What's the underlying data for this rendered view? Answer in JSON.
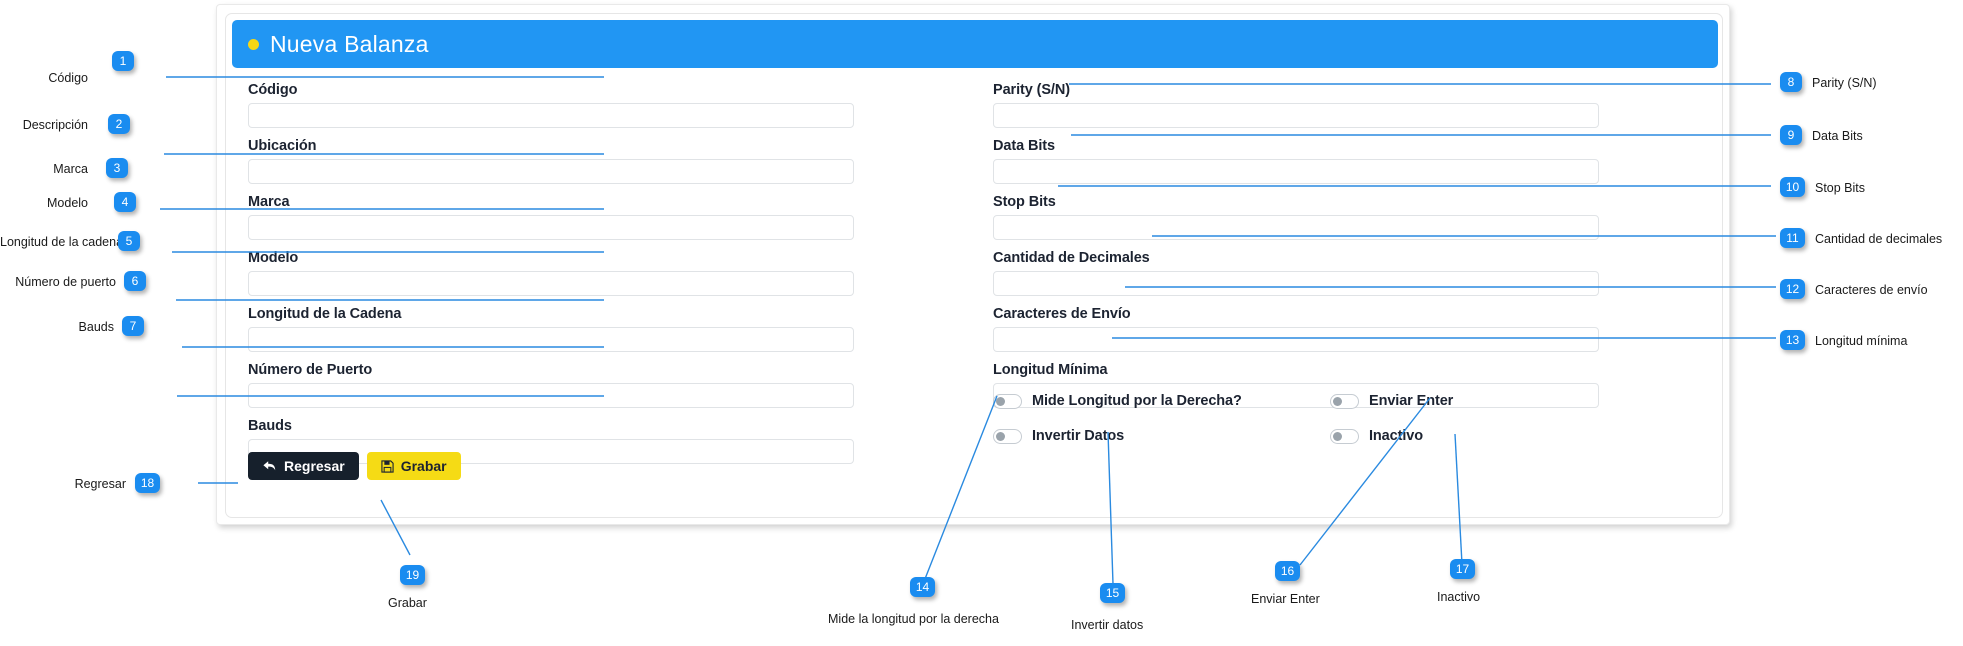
{
  "header": {
    "title": "Nueva Balanza",
    "dot_color": "#f7d714",
    "bar_color": "#2196f3"
  },
  "form": {
    "left_fields": [
      {
        "label": "Código",
        "value": "",
        "placeholder": ""
      },
      {
        "label": "Ubicación",
        "value": "",
        "placeholder": ""
      },
      {
        "label": "Marca",
        "value": "",
        "placeholder": ""
      },
      {
        "label": "Modelo",
        "value": "",
        "placeholder": ""
      },
      {
        "label": "Longitud de la Cadena",
        "value": "",
        "placeholder": ""
      },
      {
        "label": "Número de Puerto",
        "value": "",
        "placeholder": ""
      },
      {
        "label": "Bauds",
        "value": "",
        "placeholder": ""
      }
    ],
    "right_fields": [
      {
        "label": "Parity (S/N)",
        "value": "",
        "placeholder": ""
      },
      {
        "label": "Data Bits",
        "value": "",
        "placeholder": ""
      },
      {
        "label": "Stop Bits",
        "value": "",
        "placeholder": ""
      },
      {
        "label": "Cantidad de Decimales",
        "value": "",
        "placeholder": ""
      },
      {
        "label": "Caracteres de Envío",
        "value": "",
        "placeholder": ""
      },
      {
        "label": "Longitud Mínima",
        "value": "",
        "placeholder": ""
      }
    ],
    "toggles_left": [
      {
        "label": "Mide Longitud por la Derecha?",
        "state": "off"
      },
      {
        "label": "Invertir Datos",
        "state": "off"
      }
    ],
    "toggles_right": [
      {
        "label": "Enviar Enter",
        "state": "off"
      },
      {
        "label": "Inactivo",
        "state": "off"
      }
    ]
  },
  "buttons": {
    "back": {
      "label": "Regresar",
      "icon": "back-arrow-icon",
      "bg": "#16202c",
      "fg": "#ffffff"
    },
    "save": {
      "label": "Grabar",
      "icon": "floppy-disk-icon",
      "bg": "#f5db15",
      "fg": "#1c2331"
    }
  },
  "annotations": {
    "accent_color": "#1a8cf0",
    "items": [
      {
        "n": "1",
        "text": "Código"
      },
      {
        "n": "2",
        "text": "Descripción"
      },
      {
        "n": "3",
        "text": "Marca"
      },
      {
        "n": "4",
        "text": "Modelo"
      },
      {
        "n": "5",
        "text": "Longitud de la cadena"
      },
      {
        "n": "6",
        "text": "Número de puerto"
      },
      {
        "n": "7",
        "text": "Bauds"
      },
      {
        "n": "8",
        "text": "Parity (S/N)"
      },
      {
        "n": "9",
        "text": "Data Bits"
      },
      {
        "n": "10",
        "text": "Stop Bits"
      },
      {
        "n": "11",
        "text": "Cantidad de decimales"
      },
      {
        "n": "12",
        "text": "Caracteres de envío"
      },
      {
        "n": "13",
        "text": "Longitud mínima"
      },
      {
        "n": "14",
        "text": "Mide la longitud por la derecha"
      },
      {
        "n": "15",
        "text": "Invertir datos"
      },
      {
        "n": "16",
        "text": "Enviar Enter"
      },
      {
        "n": "17",
        "text": "Inactivo"
      },
      {
        "n": "18",
        "text": "Regresar"
      },
      {
        "n": "19",
        "text": "Grabar"
      }
    ]
  }
}
